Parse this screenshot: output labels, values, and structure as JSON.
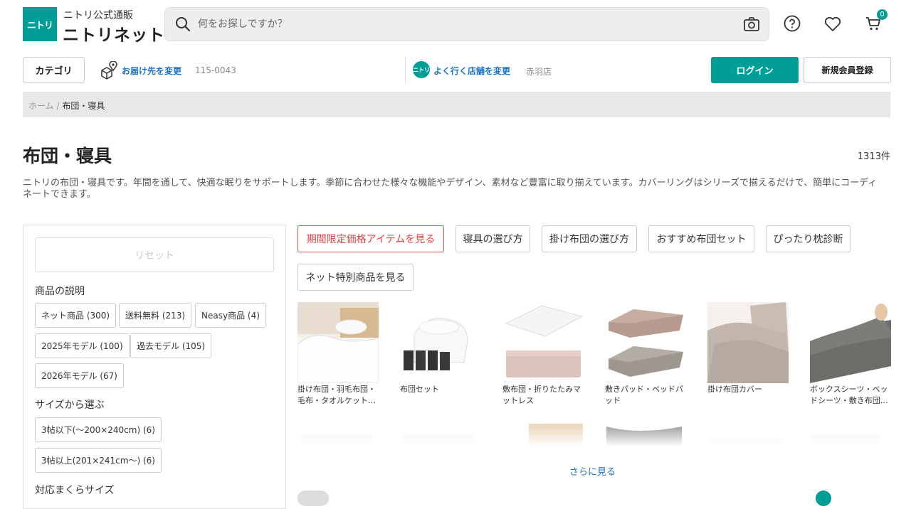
{
  "header": {
    "logo_icon_text": "ニトリ",
    "logo_sub": "ニトリ公式通販",
    "logo_main": "ニトリネット",
    "search_placeholder": "何をお探しですか？",
    "cart_count": "0"
  },
  "subheader": {
    "category_label": "カテゴリ",
    "delivery_link": "お届け先を変更",
    "delivery_zip": "115-0043",
    "store_icon_text": "ニトリ",
    "store_link": "よく行く店舗を変更",
    "store_name": "赤羽店",
    "login_label": "ログイン",
    "register_label": "新規会員登録"
  },
  "breadcrumb": {
    "home": "ホーム",
    "separator": "/",
    "current": "布団・寝具"
  },
  "page": {
    "title": "布団・寝具",
    "count": "1313件",
    "description": "ニトリの布団・寝具です。年間を通して、快適な眠りをサポートします。季節に合わせた様々な機能やデザイン、素材など豊富に取り揃えています。カバーリングはシリーズで揃えるだけで、簡単にコーディネートできます。"
  },
  "sidebar": {
    "reset_label": "リセット",
    "product_desc_heading": "商品の説明",
    "product_desc_chips": [
      "ネット商品 (300)",
      "送料無料 (213)",
      "Neasy商品 (4)",
      "2025年モデル (100)",
      "過去モデル (105)",
      "2026年モデル (67)"
    ],
    "size_heading": "サイズから選ぶ",
    "size_chips": [
      "3帖以下(～200×240cm) (6)",
      "3帖以上(201×241cm～) (6)"
    ],
    "pillow_heading": "対応まくらサイズ"
  },
  "guides": [
    "期間限定価格アイテムを見る",
    "寝具の選び方",
    "掛け布団の選び方",
    "おすすめ布団セット",
    "ぴったり枕診断",
    "ネット特別商品を見る"
  ],
  "categories": [
    {
      "label": "掛け布団・羽毛布団・毛布・タオルケット…"
    },
    {
      "label": "布団セット"
    },
    {
      "label": "敷布団・折りたたみマットレス"
    },
    {
      "label": "敷きパッド・ベッドパッド"
    },
    {
      "label": "掛け布団カバー"
    },
    {
      "label": "ボックスシーツ・ベッドシーツ・敷き布団…"
    }
  ],
  "more_label": "さらに見る",
  "colors": {
    "brand": "#009e96",
    "link": "#1a73c9",
    "accent_red": "#e04040"
  }
}
